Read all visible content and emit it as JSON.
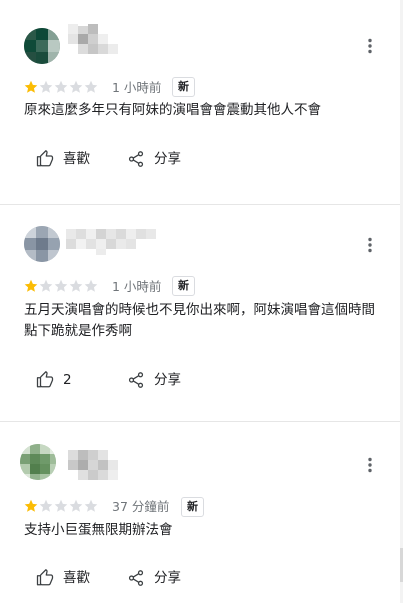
{
  "reviews": [
    {
      "rating_stars": 1,
      "max_stars": 5,
      "time": "1 小時前",
      "badge": "新",
      "text": "原來這麼多年只有阿妹的演唱會會震動其他人不會",
      "like_label": "喜歡",
      "share_label": "分享",
      "avatar_colors": [
        "#4f6e60",
        "#0f4a38",
        "#7c9488",
        "#2e5a4b"
      ]
    },
    {
      "rating_stars": 1,
      "max_stars": 5,
      "time": "1 小時前",
      "badge": "新",
      "text": "五月天演唱會的時候也不見你出來啊，阿妹演唱會這個時間點下跪就是作秀啊",
      "like_label": "2",
      "share_label": "分享",
      "avatar_colors": [
        "#9aa6b4",
        "#7c8898",
        "#b7c0ca",
        "#8d98a6"
      ]
    },
    {
      "rating_stars": 1,
      "max_stars": 5,
      "time": "37 分鐘前",
      "badge": "新",
      "text": "支持小巨蛋無限期辦法會",
      "like_label": "喜歡",
      "share_label": "分享",
      "avatar_colors": [
        "#8fae8a",
        "#5b8457",
        "#b5ccb0",
        "#6f9a6a"
      ]
    }
  ],
  "colors": {
    "star_filled": "#fbbc04",
    "star_empty": "#dadce0",
    "secondary_text": "#70757a"
  },
  "icons": [
    "more-vert-icon",
    "thumb-up-icon",
    "share-icon",
    "star-icon"
  ]
}
